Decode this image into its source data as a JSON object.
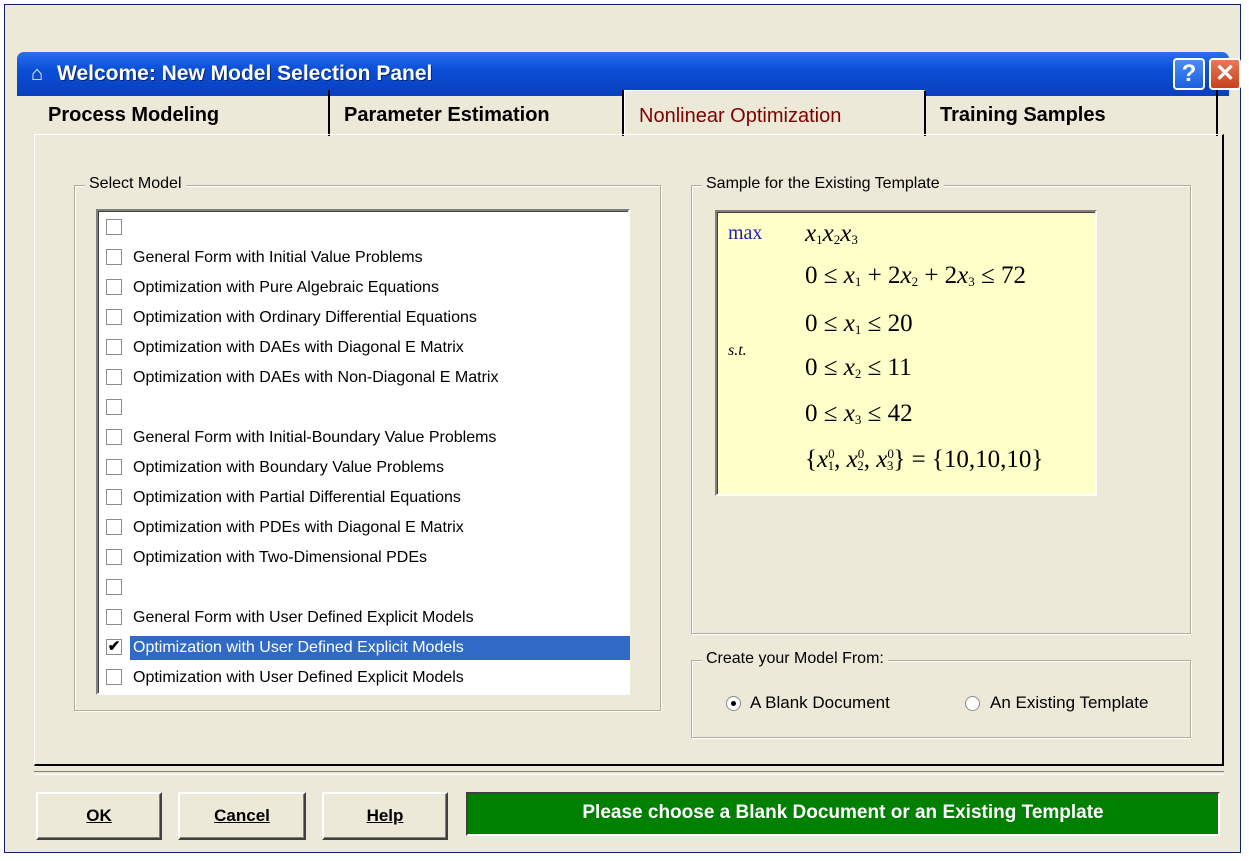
{
  "window": {
    "title": "Welcome:  New Model Selection Panel",
    "help_glyph": "?",
    "close_glyph": "✕",
    "icon": "house-icon"
  },
  "tabs": [
    {
      "label": "Process Modeling"
    },
    {
      "label": "Parameter Estimation"
    },
    {
      "label": "Nonlinear Optimization"
    },
    {
      "label": "Training Samples"
    }
  ],
  "active_tab": "Nonlinear Optimization",
  "select_model": {
    "title": "Select Model",
    "items": [
      {
        "label": "",
        "checked": false
      },
      {
        "label": "General Form with Initial Value Problems",
        "checked": false
      },
      {
        "label": "Optimization with Pure Algebraic Equations",
        "checked": false
      },
      {
        "label": "Optimization with Ordinary Differential Equations",
        "checked": false
      },
      {
        "label": "Optimization with DAEs with Diagonal E Matrix",
        "checked": false
      },
      {
        "label": "Optimization with DAEs with Non-Diagonal E Matrix",
        "checked": false
      },
      {
        "label": "",
        "checked": false
      },
      {
        "label": "General Form with Initial-Boundary Value Problems",
        "checked": false
      },
      {
        "label": "Optimization with Boundary Value Problems",
        "checked": false
      },
      {
        "label": "Optimization with Partial Differential Equations",
        "checked": false
      },
      {
        "label": "Optimization with PDEs with Diagonal E Matrix",
        "checked": false
      },
      {
        "label": "Optimization with Two-Dimensional PDEs",
        "checked": false
      },
      {
        "label": "",
        "checked": false
      },
      {
        "label": "General Form with User Defined Explicit Models",
        "checked": false
      },
      {
        "label": "Optimization with User Defined Explicit Models",
        "checked": true
      },
      {
        "label": "Optimization with User Defined Explicit Models",
        "checked": false
      }
    ],
    "selected_index": 14
  },
  "sample": {
    "title": "Sample for the Existing Template",
    "max_label": "max",
    "st_label": "s.t.",
    "objective": "x1x2x3",
    "constraints": [
      "0 ≤ x1 + 2x2 + 2x3 ≤ 72",
      "0 ≤ x1 ≤ 20",
      "0 ≤ x2 ≤ 11",
      "0 ≤ x3 ≤ 42",
      "{x1^0, x2^0, x3^0} = {10,10,10}"
    ]
  },
  "create_from": {
    "title": "Create your Model From:",
    "options": [
      {
        "label": "A Blank Document",
        "selected": true
      },
      {
        "label": "An Existing Template",
        "selected": false
      }
    ]
  },
  "buttons": {
    "ok": "OK",
    "cancel": "Cancel",
    "help": "Help"
  },
  "status": {
    "text": "Please choose a Blank Document or an Existing Template",
    "color": "#008000"
  }
}
